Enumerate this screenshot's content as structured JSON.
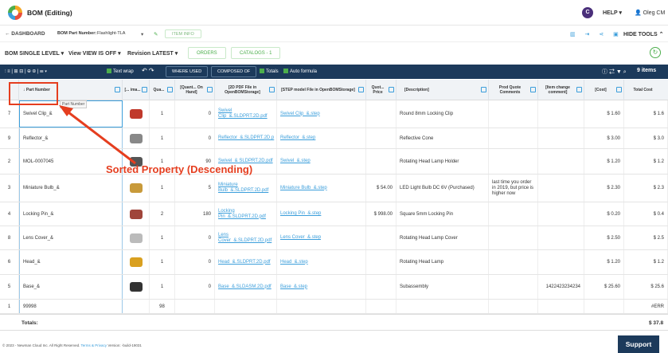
{
  "app": {
    "title": "BOM (Editing)",
    "user_initial": "C",
    "help": "HELP ▾",
    "user": "Oleg CM"
  },
  "subbar": {
    "dashboard": "← DASHBOARD",
    "pn_label": "BOM Part Number:",
    "pn_value": "Flashlight-TLA",
    "caret": "▾",
    "edit": "✎",
    "item_info": "ITEM INFO",
    "icons": "▥ ⇥ ⋖ ▣",
    "hide_tools": "HIDE TOOLS ⌃"
  },
  "toolbar": {
    "bom_level": "BOM SINGLE LEVEL ▾",
    "view": "View VIEW IS OFF ▾",
    "revision": "Revision LATEST ▾",
    "orders": "ORDERS",
    "catalogs": "CATALOGS - 1",
    "refresh": "↻"
  },
  "gridbar": {
    "icons_left": "⫶ ≡ | ⊞ ⊟ | ⊕ ⊗ | ☰ ▾",
    "text_wrap": "Text wrap",
    "undo_redo": "↶ ↷",
    "where_used": "WHERE USED",
    "composed_of": "COMPOSED OF",
    "totals": "Totals",
    "auto_formula": "Auto formula",
    "right_icons": "ⓘ ⇄ ▼ ⌕",
    "items": "9 items"
  },
  "columns": [
    "↓ Part Number",
    "[... ima...",
    "Qua...",
    "[Quant... On Hand]",
    "[2D PDF File in OpenBOMStorage]",
    "[STEP model File in OpenBOMStorage]",
    "Quot... Price",
    "[Description]",
    "Prod Quote Comments",
    "[Item change comment]",
    "[Cost]",
    "Total Cost"
  ],
  "rows": [
    {
      "num": "7",
      "part": "Swivel Clip_&",
      "qty": "1",
      "onhand": "0",
      "pdf": "Swivel Clip_&.SLDPRT.2D.pdf",
      "step": "Swivel Clip_&.step",
      "quote": "",
      "desc": "Round 8mm Locking Clip",
      "comments": "",
      "change": "",
      "cost": "$ 1.60",
      "total": "$ 1.6",
      "thumb": "#c0392b"
    },
    {
      "num": "9",
      "part": "Reflector_&",
      "qty": "1",
      "onhand": "0",
      "pdf": "Reflector_&.SLDPRT.2D.p",
      "step": "Reflector_&.step",
      "quote": "",
      "desc": "Reflective Cone",
      "comments": "",
      "change": "",
      "cost": "$ 3.00",
      "total": "$ 3.0",
      "thumb": "#888888"
    },
    {
      "num": "2",
      "part": "MOL-0007045",
      "qty": "1",
      "onhand": "90",
      "pdf": "Swivel_& SLDPRT.2D.pdf",
      "step": "Swivel_&.step",
      "quote": "",
      "desc": "Rotating Head Lamp Holder",
      "comments": "",
      "change": "",
      "cost": "$ 1.20",
      "total": "$ 1.2",
      "thumb": "#555555"
    },
    {
      "num": "3",
      "part": "Miniature Bulb_&",
      "qty": "1",
      "onhand": "5",
      "pdf": "Miniature Bulb_&.SLDPRT.2D.pdf",
      "step": "Miniature Bulb_&.step",
      "quote": "$ 54.00",
      "desc": "LED Light Bulb DC 6V (Purchased)",
      "comments": "last time you order in 2019, but price is higher now",
      "change": "",
      "cost": "$ 2.30",
      "total": "$ 2.3",
      "thumb": "#c89a3a"
    },
    {
      "num": "4",
      "part": "Locking Pin_&",
      "qty": "2",
      "onhand": "180",
      "pdf": "Locking Pin_&.SLDPRT.2D.pdf",
      "step": "Locking Pin_&.step",
      "quote": "$ 998.00",
      "desc": "Square 5mm Locking Pin",
      "comments": "",
      "change": "",
      "cost": "$ 0.20",
      "total": "$ 0.4",
      "thumb": "#a0453a"
    },
    {
      "num": "8",
      "part": "Lens Cover_&",
      "qty": "1",
      "onhand": "0",
      "pdf": "Lens Cover_&.SLDPRT.2D.pdf",
      "step": "Lens Cover_&.step",
      "quote": "",
      "desc": "Rotating Head Lamp Cover",
      "comments": "",
      "change": "",
      "cost": "$ 2.50",
      "total": "$ 2.5",
      "thumb": "#bbbbbb"
    },
    {
      "num": "6",
      "part": "Head_&",
      "qty": "1",
      "onhand": "0",
      "pdf": "Head_&.SLDPRT.2D.pdf",
      "step": "Head_&.step",
      "quote": "",
      "desc": "Rotating Head Lamp",
      "comments": "",
      "change": "",
      "cost": "$ 1.20",
      "total": "$ 1.2",
      "thumb": "#d9a020"
    },
    {
      "num": "5",
      "part": "Base_&",
      "qty": "1",
      "onhand": "0",
      "pdf": "Base_&.SLDASM.2D.pdf",
      "step": "Base_&.step",
      "quote": "",
      "desc": "Subassembly",
      "comments": "",
      "change": "1422423234234",
      "cost": "$ 25.60",
      "total": "$ 25.6",
      "thumb": "#333333"
    },
    {
      "num": "1",
      "part": "99998",
      "qty": "98",
      "onhand": "",
      "pdf": "",
      "step": "",
      "quote": "",
      "desc": "",
      "comments": "",
      "change": "",
      "cost": "",
      "total": "#ERR",
      "thumb": ""
    }
  ],
  "totals": {
    "label": "Totals:",
    "value": "$ 37.8"
  },
  "footer": {
    "copyright": "© 2023 - Newman Cloud Inc. All Right Reserved.",
    "terms": "Terms & Privacy",
    "version": "Version: -build-19031"
  },
  "support": "Support",
  "annotation": {
    "tooltip": "Part Number",
    "text": "Sorted Property (Descending)"
  }
}
